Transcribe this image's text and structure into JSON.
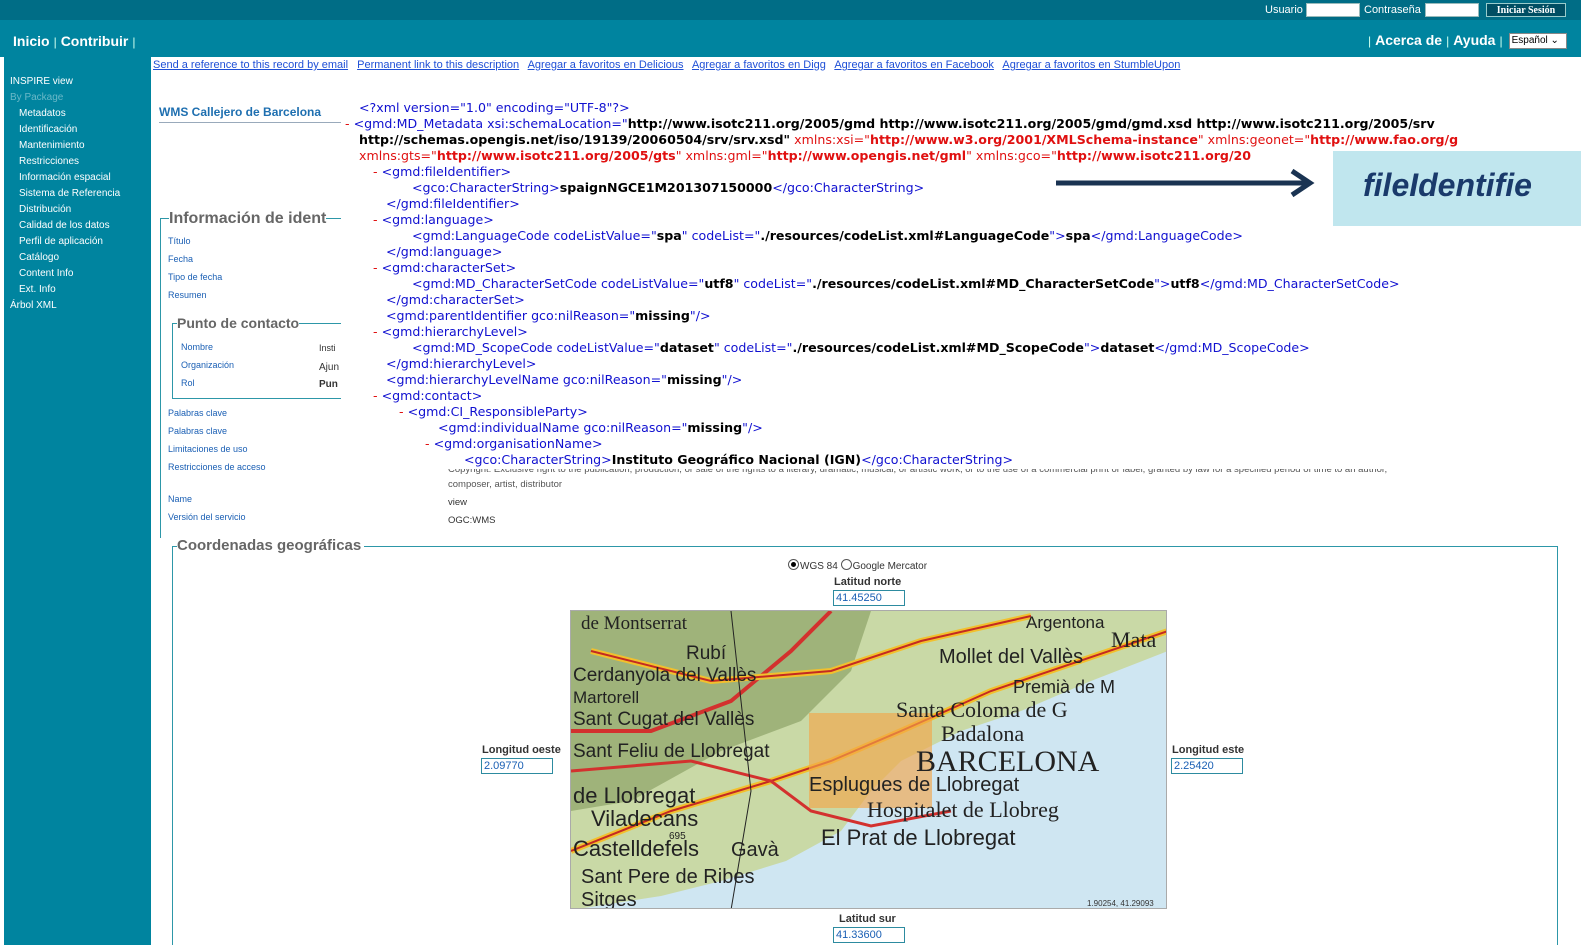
{
  "login": {
    "user_label": "Usuario",
    "password_label": "Contraseña",
    "login_button": "Iniciar Sesión"
  },
  "nav": {
    "left": [
      "Inicio",
      "Contribuir"
    ],
    "right": [
      "Acerca de",
      "Ayuda"
    ],
    "language": "Español"
  },
  "sidebar": {
    "items": [
      "INSPIRE view",
      "By Package",
      "Metadatos",
      "Identificación",
      "Mantenimiento",
      "Restricciones",
      "Información espacial",
      "Sistema de Referencia",
      "Distribución",
      "Calidad de los datos",
      "Perfil de aplicación",
      "Catálogo",
      "Content Info",
      "Ext. Info",
      "Árbol XML"
    ]
  },
  "links": [
    "Send a reference to this record by email",
    "Permanent link to this description",
    "Agregar a favoritos en Delicious",
    "Agregar a favoritos en Digg",
    "Agregar a favoritos en Facebook",
    "Agregar a favoritos en StumbleUpon"
  ],
  "record_title": "WMS Callejero de Barcelona",
  "ident": {
    "title": "Información de ident",
    "fields": [
      "Título",
      "Fecha",
      "Tipo de fecha",
      "Resumen"
    ]
  },
  "contact": {
    "title": "Punto de contacto",
    "labels": [
      "Nombre",
      "Organización",
      "Rol"
    ],
    "values": [
      "Insti",
      "Ajun",
      "Pun"
    ]
  },
  "keywords": {
    "labels": [
      "Palabras clave",
      "Palabras clave",
      "Limitaciones de uso",
      "Restricciones de acceso"
    ],
    "rights_text": "Copyright: Exclusive right to the publication, production, or sale of the rights to a literary, dramatic, musical, or artistic work, or to the use of a commercial print or label, granted by law for a specified period of time to an author,",
    "rights_text2": "composer, artist, distributor"
  },
  "service": {
    "name_label": "Name",
    "name_value": "view",
    "version_label": "Versión del servicio",
    "version_value": "OGC:WMS"
  },
  "callout": {
    "text": "fileIdentifie"
  },
  "xml": {
    "decl": "<?xml version=\"1.0\" encoding=\"UTF-8\"?>",
    "root_start": "<gmd:MD_Metadata xsi:schemaLocation=\"",
    "root_schema1": "http://www.isotc211.org/2005/gmd http://www.isotc211.org/2005/gmd/gmd.xsd http://www.isotc211.org/2005/srv",
    "root_schema2": "http://schemas.opengis.net/iso/19139/20060504/srv/srv.xsd",
    "xsi_attr": " xmlns:xsi=\"",
    "xsi_val": "http://www.w3.org/2001/XMLSchema-instance",
    "geonet_attr": "\" xmlns:geonet=\"",
    "geonet_val": "http://www.fao.org/g",
    "gts_attr": "xmlns:gts=\"",
    "gts_val": "http://www.isotc211.org/2005/gts",
    "gml_attr": "\" xmlns:gml=\"",
    "gml_val": "http://www.opengis.net/gml",
    "gco_attr": "\" xmlns:gco=\"",
    "gco_val": "http://www.isotc211.org/20",
    "fileid_open": "<gmd:fileIdentifier>",
    "cs_open": "<gco:CharacterString>",
    "fileid_val": "spaignNGCE1M201307150000",
    "cs_close": "</gco:CharacterString>",
    "fileid_close": "</gmd:fileIdentifier>",
    "lang_open": "<gmd:language>",
    "langcode_a": "<gmd:LanguageCode codeListValue=\"",
    "langcode_v": "spa",
    "langcode_b": "\" codeList=\"",
    "langcode_list": "./resources/codeList.xml#LanguageCode",
    "langcode_c": "\">",
    "langcode_val": "spa",
    "langcode_close": "</gmd:LanguageCode>",
    "lang_close": "</gmd:language>",
    "cs_set_open": "<gmd:characterSet>",
    "csc_a": "<gmd:MD_CharacterSetCode codeListValue=\"",
    "csc_v": "utf8",
    "csc_b": "\" codeList=\"",
    "csc_list": "./resources/codeList.xml#MD_CharacterSetCode",
    "csc_c": "\">",
    "csc_val": "utf8",
    "csc_close": "</gmd:MD_CharacterSetCode>",
    "cs_set_close": "</gmd:characterSet>",
    "parent_a": "<gmd:parentIdentifier gco:nilReason=\"",
    "parent_v": "missing",
    "parent_b": "\"/>",
    "hl_open": "<gmd:hierarchyLevel>",
    "sc_a": "<gmd:MD_ScopeCode codeListValue=\"",
    "sc_v": "dataset",
    "sc_b": "\" codeList=\"",
    "sc_list": "./resources/codeList.xml#MD_ScopeCode",
    "sc_c": "\">",
    "sc_val": "dataset",
    "sc_close": "</gmd:MD_ScopeCode>",
    "hl_close": "</gmd:hierarchyLevel>",
    "hln_a": "<gmd:hierarchyLevelName gco:nilReason=\"",
    "hln_v": "missing",
    "hln_b": "\"/>",
    "contact_open": "<gmd:contact>",
    "rp_open": "<gmd:CI_ResponsibleParty>",
    "ind_a": "<gmd:individualName gco:nilReason=\"",
    "ind_v": "missing",
    "ind_b": "\"/>",
    "org_open": "<gmd:organisationName>",
    "org_val": "Instituto Geográfico Nacional (IGN)"
  },
  "coords": {
    "title": "Coordenadas geográficas",
    "proj_options": [
      "WGS 84",
      "Google Mercator"
    ],
    "north_label": "Latitud norte",
    "north": "41.45250",
    "west_label": "Longitud oeste",
    "west": "2.09770",
    "east_label": "Longitud este",
    "east": "2.25420",
    "south_label": "Latitud sur",
    "south": "41.33600",
    "cursor": "1.90254, 41.29093"
  },
  "map_labels": [
    "de Montserrat",
    "Rubí",
    "Cerdanyola del Vallès",
    "Martorell",
    "Sant Cugat del Vallès",
    "Mollet del Vallès",
    "Premià de M",
    "Santa Coloma de G",
    "Badalona",
    "BARCELONA",
    "Esplugues de Llobregat",
    "Hospitalet de Llobreg",
    "El Prat de Llobregat",
    "de Llobregat",
    "Viladecans",
    "Castelldefels",
    "Gavà",
    "Sant Pere de Ribes",
    "Sitges",
    "Argentona",
    "Mata",
    "Sant Feliu de Llobregat",
    "695"
  ]
}
